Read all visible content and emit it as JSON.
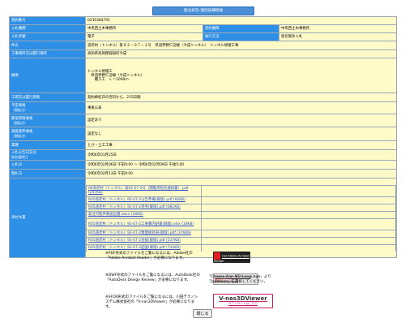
{
  "title": "発注状況･個別詳細情報",
  "rows": [
    {
      "label": "契約番号",
      "value": "0230384701"
    },
    {
      "label": "入札機関",
      "value": "中央西土木事務所",
      "label2": "契約機関",
      "value2": "中央西土木事務所"
    },
    {
      "label": "入札手順",
      "value": "電子",
      "label2": "執行方法",
      "value2": "指名競争入札"
    },
    {
      "label": "件名",
      "value": "道老村（トンネル）第９２－０７－２号　県道伊野仁淀線（今成トンネル）　トンネル修繕工事"
    },
    {
      "label": "工事場所又は履行場所",
      "value": "高知県高岡郡越知町今成"
    },
    {
      "label": "概要",
      "lines": [
        "トンネル修繕工",
        "　県道伊野仁淀線（今成トンネル）",
        "　　覆工工　Ｌ＝1000ｍ"
      ]
    },
    {
      "label": "工期又は履行期限",
      "value": "契約締結日の翌日から、215日間"
    },
    {
      "label": "予定価格",
      "sub": "（税抜き）",
      "value": "事後公表"
    },
    {
      "label": "最低制限価格",
      "sub": "（税抜き）",
      "value": "設定あり"
    },
    {
      "label": "調査基準価格",
      "sub": "（税抜き）",
      "value": "設定なし"
    },
    {
      "label": "業種",
      "value": "とび・土工工事"
    },
    {
      "label": "入札公告日又は",
      "sub": "指名通知日",
      "value": "令和6年01月25日"
    },
    {
      "label": "入札日",
      "value": "令和6年02月06日 午前9:00 ～ 令和6年02月09日 午後5:00"
    },
    {
      "label": "開札日",
      "value": "令和6年02月13日 午前9:00"
    }
  ],
  "documents": {
    "label": "添付文書",
    "items": [
      {
        "left": "06道老村（トンネル）第92-07-2号（閲覧用指名通知書）.pdf (247KB)",
        "right": ""
      },
      {
        "left": "R05道老村（トンネル）92-07-2公告準備(廃版).pdf (92KB)",
        "right": ""
      },
      {
        "left": "R05道老村（トンネル）92-07-2参考(廃版).pdf (681KB)",
        "right": ""
      },
      {
        "left": "発注可能件数届出書.docx (18KB)",
        "right": ""
      },
      {
        "left": "R05道老村（トンネル）92-07-2工事費内訳書(廃版).xlsx (18KB)",
        "right": ""
      },
      {
        "left": "R05道老村（トンネル）92-07-2数量総括表(廃版).pdf (376KB)",
        "right": ""
      },
      {
        "left": "R05道老村（トンネル）92-07-2金抜(廃版).pdf (537KB)",
        "right": ""
      },
      {
        "left": "R05道老村（トンネル）92-07-2図面(廃版).pdf (744KB)",
        "right": ""
      }
    ]
  },
  "footer": {
    "pdf_note": "※PDF形式のファイルをご覧になるには、Adobe社の「Adobe Acrobat Reader」が必要になります。",
    "adobe_banner": "Get Adobe Acrobat Reader",
    "dwf_note": "※DWF形式のファイルをご覧になるには、AutoDesk社の「AutoDesk Design Review」が必要になります。",
    "autodesk_banner_1": "Autodesk Design Review",
    "autodesk_banner_2": "無料ダウンロード",
    "language_note": "「Choose Your MSI Language」より「Japanese」を選択してください。",
    "sfx_note": "※SFOX形式のファイルをご覧になるには、川田テクノシステム株式会社の「V-nas3DViewer」が必要になります。",
    "v3d_banner_1": "V-nas3DViewer",
    "v3d_banner_2": "ダウンロードはこちら",
    "close_label": "閉じる"
  }
}
